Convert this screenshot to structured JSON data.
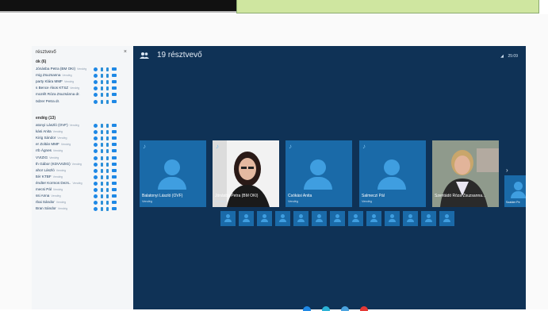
{
  "sidebar": {
    "title": "résztvevő",
    "close_label": "×",
    "group1_label": "ók (6)",
    "group2_label": "endég (13)",
    "group1": [
      {
        "name": "Jónásba Petra (BM OKI)",
        "role": "Vendég"
      },
      {
        "name": "rnig Zsuzsanna",
        "role": "Vendég"
      },
      {
        "name": "party Klára MMF",
        "role": "Vendég"
      },
      {
        "name": "s Bence Ákos KTSZ",
        "role": "Vendég"
      },
      {
        "name": "mozélt Róza Zsuzsánna dr.",
        "role": ""
      },
      {
        "name": "ödzer Petra dr.",
        "role": ""
      }
    ],
    "group2": [
      {
        "name": "atonyi László (OVF)",
        "role": "Vendég"
      },
      {
        "name": "kási Anita",
        "role": "Vendég"
      },
      {
        "name": "Kirig Sándor",
        "role": "Vendég"
      },
      {
        "name": "er Zoltán MMF",
        "role": "Vendég"
      },
      {
        "name": "rrb Ágnes",
        "role": "Vendég"
      },
      {
        "name": "VVIZIG",
        "role": "Vendég"
      },
      {
        "name": "th Gábor (KDVVIZIG)",
        "role": "Vendég"
      },
      {
        "name": "ahor László",
        "role": "Vendég"
      },
      {
        "name": "ttér KTBF",
        "role": "Vendég"
      },
      {
        "name": "éndter Kormos Dezs..",
        "role": "Vendég"
      },
      {
        "name": "mecsi Pál",
        "role": "Vendég"
      },
      {
        "name": "ssi Anna",
        "role": "Vendég"
      },
      {
        "name": "rbai Sándor",
        "role": "Vendég"
      },
      {
        "name": "Bran Sándor",
        "role": "Vendég"
      }
    ]
  },
  "call": {
    "participant_count": "19 résztvevő",
    "signal": "◢",
    "time": "25:09",
    "tiles": [
      {
        "name": "Balatonyi László (OVF)",
        "role": "Vendég",
        "type": "avatar"
      },
      {
        "name": "Jónásba Petra (BM OKI)",
        "role": "Vendég",
        "type": "photo"
      },
      {
        "name": "Csókási Anita",
        "role": "Vendég",
        "type": "avatar"
      },
      {
        "name": "Salmeczi Pál",
        "role": "Vendég",
        "type": "avatar"
      },
      {
        "name": "Szentádó Róza Zsuzsanna...",
        "role": "",
        "type": "photo"
      },
      {
        "name": "Szalder Pe",
        "role": "",
        "type": "avatar"
      }
    ],
    "more_arrow": "›"
  },
  "colors": {
    "call_bg": "#0f3256",
    "tile_bg": "#1a6aa8",
    "avatar": "#3f9ee0",
    "bottom_buttons": [
      "#1e88e5",
      "#2bb2d6",
      "#4aa3df",
      "#e53935"
    ]
  }
}
